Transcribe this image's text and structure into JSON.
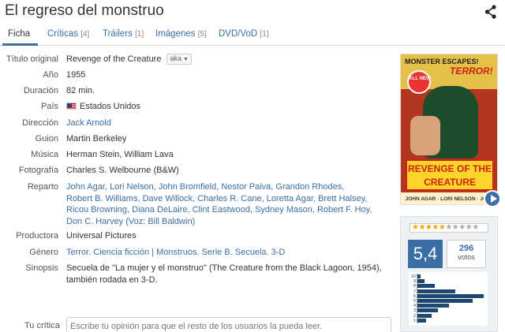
{
  "page": {
    "title": "El regreso del monstruo"
  },
  "tabs": [
    {
      "label": "Ficha",
      "count": ""
    },
    {
      "label": "Críticas",
      "count": "[4]"
    },
    {
      "label": "Tráilers",
      "count": "[1]"
    },
    {
      "label": "Imágenes",
      "count": "[5]"
    },
    {
      "label": "DVD/VoD",
      "count": "[1]"
    }
  ],
  "details": {
    "original_title_label": "Título original",
    "original_title": "Revenge of the Creature",
    "aka_label": "aka",
    "year_label": "Año",
    "year": "1955",
    "duration_label": "Duración",
    "duration": "82 min.",
    "country_label": "País",
    "country": "Estados Unidos",
    "director_label": "Dirección",
    "director": "Jack Arnold",
    "writer_label": "Guion",
    "writer": "Martin Berkeley",
    "music_label": "Música",
    "music": "Herman Stein, William Lava",
    "photography_label": "Fotografía",
    "photography": "Charles S. Welbourne (B&W)",
    "cast_label": "Reparto",
    "cast": [
      "John Agar,",
      "Lori Nelson,",
      "John Bromfield,",
      "Nestor Paiva,",
      "Grandon Rhodes,",
      "Robert B. Williams,",
      "Dave Willock,",
      "Charles R. Cane,",
      "Loretta Agar,",
      "Brett Halsey,",
      "Ricou Browning,",
      "Diana DeLaire,",
      "Clint Eastwood,",
      "Sydney Mason,",
      "Robert F. Hoy,",
      "Don C. Harvey (Voz: Bill Baldwin)"
    ],
    "producer_label": "Productora",
    "producer": "Universal Pictures",
    "genre_label": "Género",
    "genre": "Terror. Ciencia ficción | Monstruos. Serie B. Secuela. 3-D",
    "synopsis_label": "Sinopsis",
    "synopsis": "Secuela de \"La mujer y el monstruo\" (The Creature from the Black Lagoon, 1954), también rodada en 3-D."
  },
  "review": {
    "label": "Tu crítica",
    "placeholder": "Escribe tu opinión para que el resto de los usuarios la pueda leer."
  },
  "poster": {
    "banner": "MONSTER ESCAPES!",
    "burst": "ALL NEW",
    "terror": "TERROR!",
    "title_line1": "REVENGE OF THE",
    "title_line2": "CREATURE",
    "cast_strip": "JOHN AGAR · LORI NELSON · JOHN BROMFIELD"
  },
  "rating": {
    "score": "5,4",
    "votes_count": "296",
    "votes_label": "votos",
    "stars_filled": 5,
    "stars_total": 10,
    "histogram": {
      "levels": [
        "10",
        "9",
        "8",
        "7",
        "6",
        "5",
        "4",
        "3",
        "2",
        "1"
      ],
      "shares": [
        0.05,
        0.1,
        0.25,
        0.55,
        0.95,
        0.8,
        0.45,
        0.3,
        0.2,
        0.12
      ]
    }
  },
  "colors": {
    "accent": "#3a6ea5",
    "star": "#f0a500"
  },
  "icons": {
    "share": "share-icon",
    "play": "play-icon",
    "flag": "us-flag-icon"
  }
}
